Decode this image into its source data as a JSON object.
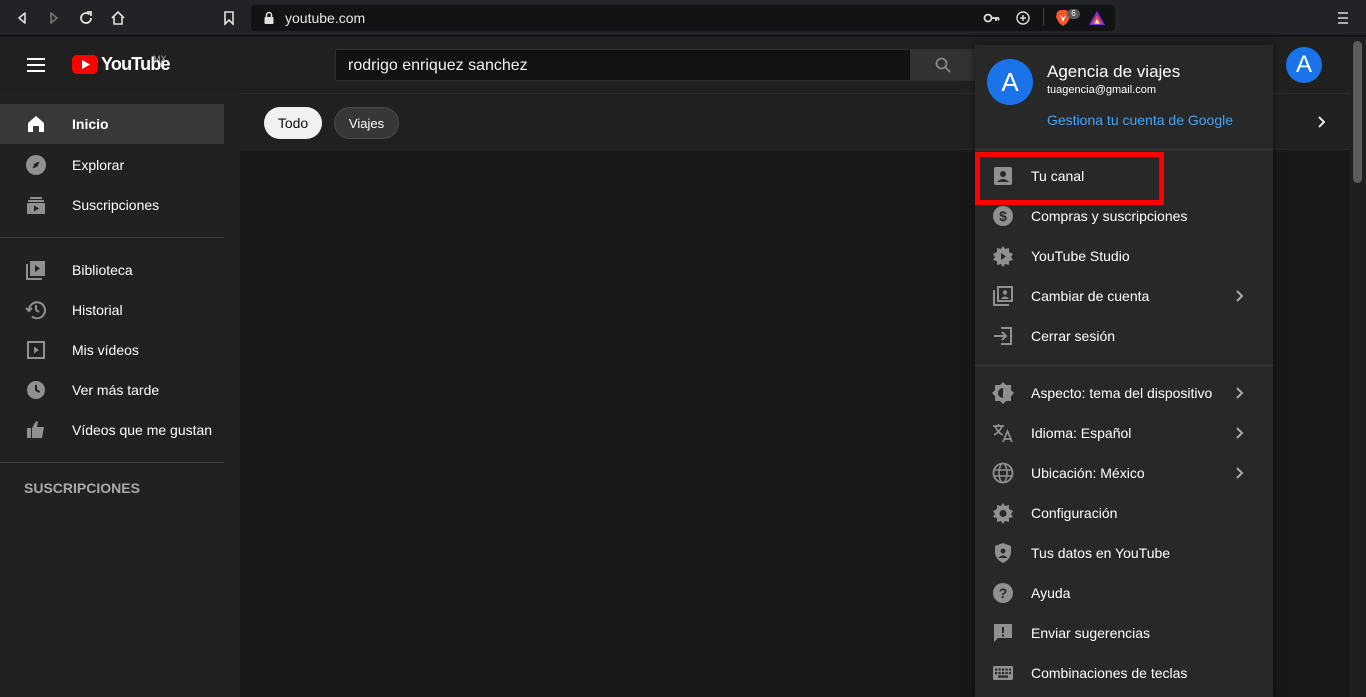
{
  "browser": {
    "url": "youtube.com",
    "extension_badge": "6"
  },
  "header": {
    "logo_text": "YouTube",
    "country_code": "MX",
    "search_value": "rodrigo enriquez sanchez",
    "avatar_letter": "A"
  },
  "sidebar": {
    "items": [
      {
        "label": "Inicio",
        "icon": "home-icon",
        "active": true
      },
      {
        "label": "Explorar",
        "icon": "compass-icon"
      },
      {
        "label": "Suscripciones",
        "icon": "subscriptions-icon"
      },
      {
        "label": "Biblioteca",
        "icon": "library-icon"
      },
      {
        "label": "Historial",
        "icon": "history-icon"
      },
      {
        "label": "Mis vídeos",
        "icon": "my-videos-icon"
      },
      {
        "label": "Ver más tarde",
        "icon": "clock-icon"
      },
      {
        "label": "Vídeos que me gustan",
        "icon": "thumbs-up-icon"
      }
    ],
    "section_title": "SUSCRIPCIONES"
  },
  "chips": [
    {
      "label": "Todo",
      "selected": true
    },
    {
      "label": "Viajes",
      "selected": false
    }
  ],
  "account_menu": {
    "avatar_letter": "A",
    "name": "Agencia de viajes",
    "email": "tuagencia@gmail.com",
    "manage_link": "Gestiona tu cuenta de Google",
    "items": [
      {
        "label": "Tu canal",
        "icon": "account-box-icon",
        "highlighted": true
      },
      {
        "label": "Compras y suscripciones",
        "icon": "dollar-icon"
      },
      {
        "label": "YouTube Studio",
        "icon": "studio-gear-icon"
      },
      {
        "label": "Cambiar de cuenta",
        "icon": "switch-account-icon",
        "submenu": true
      },
      {
        "label": "Cerrar sesión",
        "icon": "sign-out-icon"
      },
      {
        "label": "Aspecto: tema del dispositivo",
        "icon": "theme-icon",
        "submenu": true
      },
      {
        "label": "Idioma: Español",
        "icon": "translate-icon",
        "submenu": true
      },
      {
        "label": "Ubicación: México",
        "icon": "globe-icon",
        "submenu": true
      },
      {
        "label": "Configuración",
        "icon": "settings-gear-icon"
      },
      {
        "label": "Tus datos en YouTube",
        "icon": "shield-user-icon"
      },
      {
        "label": "Ayuda",
        "icon": "help-icon"
      },
      {
        "label": "Enviar sugerencias",
        "icon": "feedback-icon"
      },
      {
        "label": "Combinaciones de teclas",
        "icon": "keyboard-icon"
      }
    ]
  },
  "colors": {
    "highlight": "#ff0000",
    "link": "#3ea6ff",
    "avatar": "#1a73e8",
    "brand_red": "#ff0000"
  }
}
